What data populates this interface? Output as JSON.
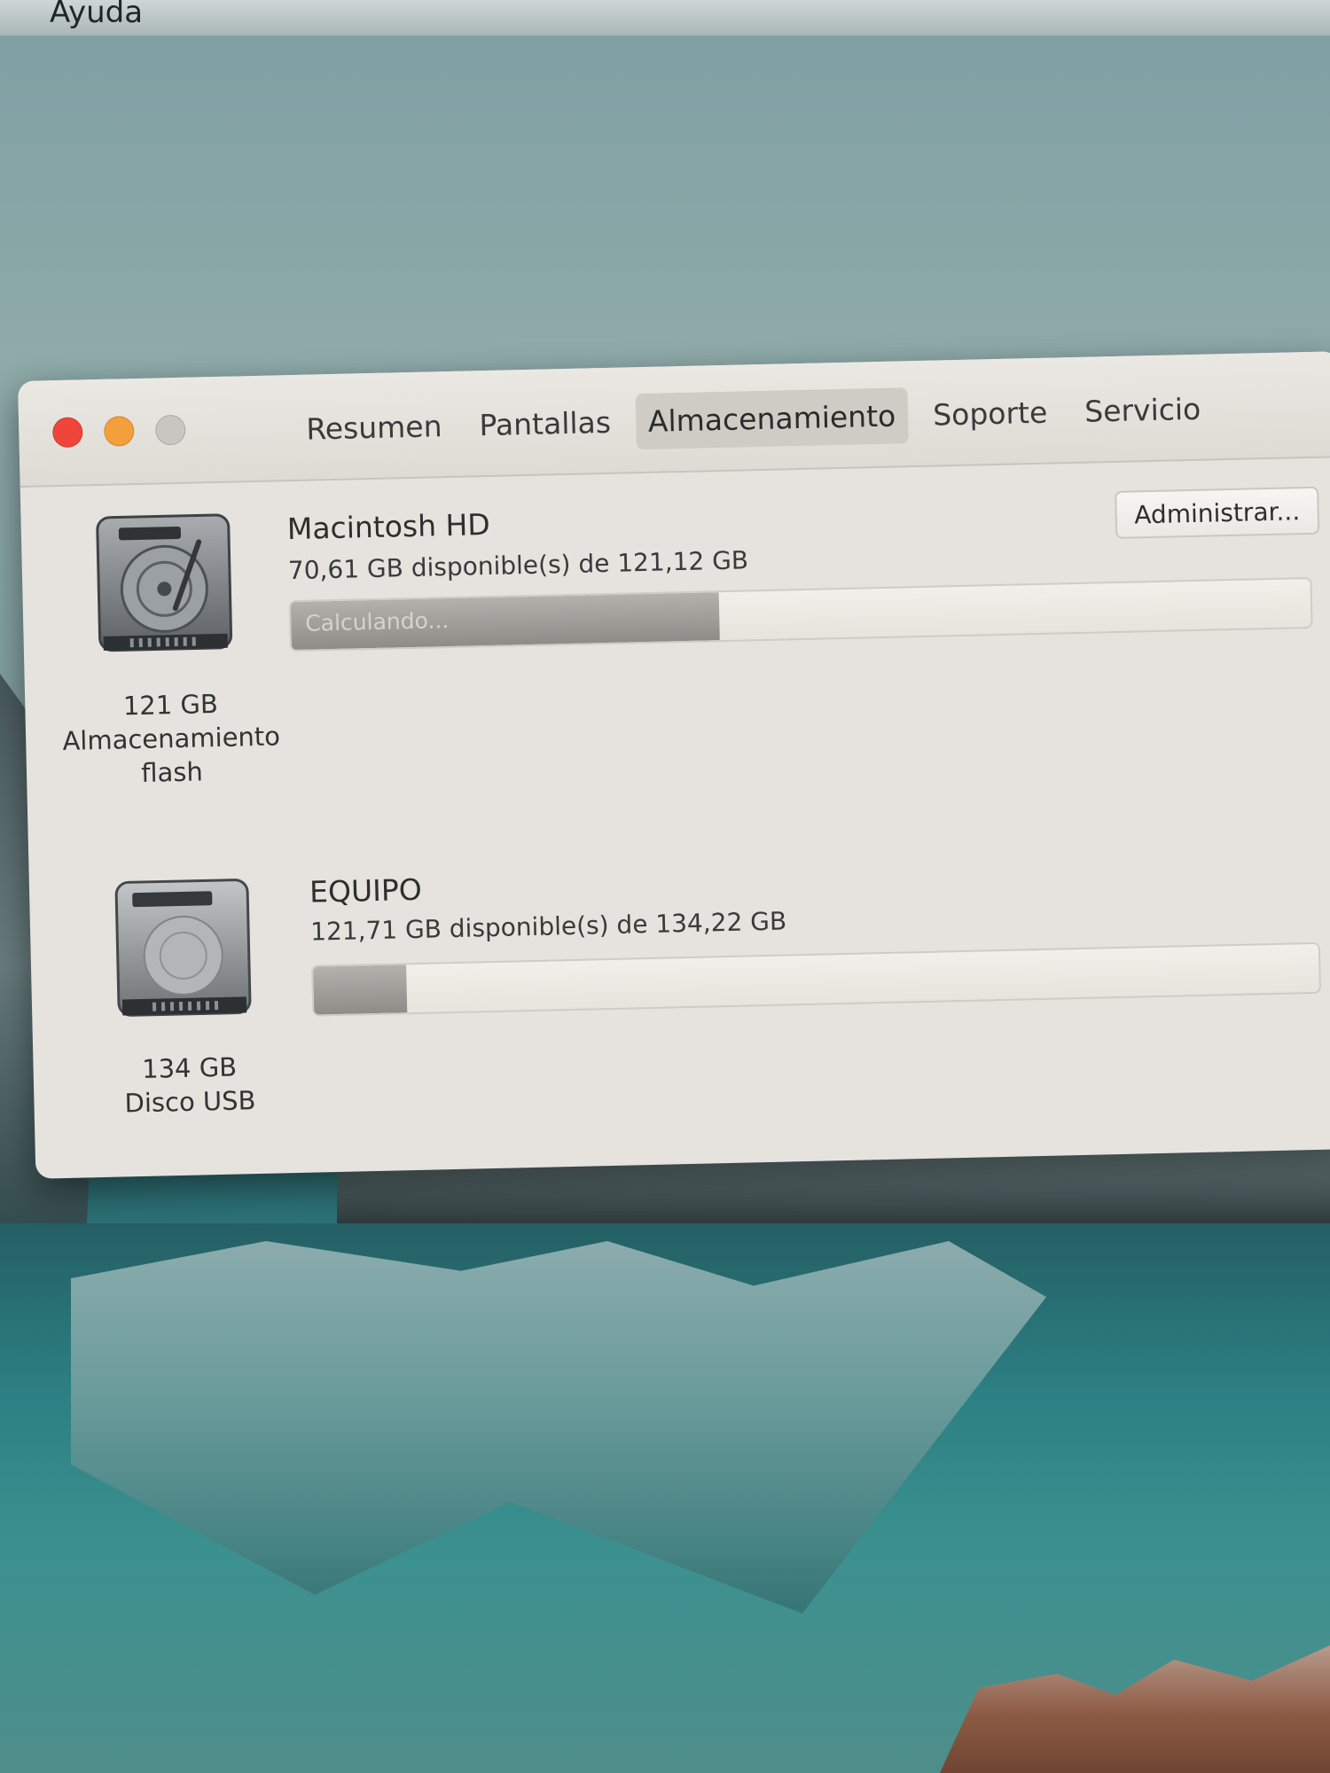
{
  "menubar": {
    "help_label": "Ayuda"
  },
  "window": {
    "tabs": [
      {
        "label": "Resumen",
        "active": false
      },
      {
        "label": "Pantallas",
        "active": false
      },
      {
        "label": "Almacenamiento",
        "active": true
      },
      {
        "label": "Soporte",
        "active": false
      },
      {
        "label": "Servicio",
        "active": false
      }
    ],
    "colors": {
      "close": "#f0453a",
      "minimize": "#f3a03c",
      "zoom": "#c9c6c1"
    }
  },
  "disks": [
    {
      "name": "Macintosh HD",
      "available": "70,61 GB disponible(s) de 121,12 GB",
      "capacity": "121 GB",
      "type_line1": "Almacenamiento",
      "type_line2": "flash",
      "used_fraction": 0.42,
      "bar_status": "Calculando...",
      "manage_label": "Administrar...",
      "icon": "hard-disk-icon"
    },
    {
      "name": "EQUIPO",
      "available": "121,71 GB disponible(s) de 134,22 GB",
      "capacity": "134 GB",
      "type_line1": "Disco USB",
      "type_line2": "",
      "used_fraction": 0.093,
      "icon": "usb-disk-icon"
    }
  ]
}
